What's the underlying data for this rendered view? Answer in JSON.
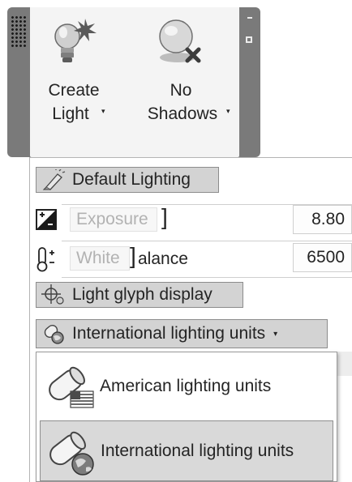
{
  "ribbon": {
    "create_light": {
      "line1": "Create",
      "line2": "Light",
      "caret": "▾",
      "icon": "light-bulb-star-icon"
    },
    "no_shadows": {
      "line1": "No",
      "line2": "Shadows",
      "caret": "▾",
      "icon": "sphere-shadow-off-icon"
    }
  },
  "panel": {
    "default_lighting": {
      "label": "Default Lighting",
      "icon": "pencil-light-icon"
    },
    "exposure": {
      "placeholder": "Exposure",
      "value": "8.80",
      "icon": "exposure-icon"
    },
    "white_balance": {
      "placeholder": "White",
      "text": "alance",
      "value": "6500",
      "icon": "thermometer-icon"
    },
    "light_glyph": {
      "label": "Light glyph display",
      "icon": "light-glyph-icon"
    },
    "units": {
      "label": "International lighting units",
      "caret": "▾",
      "icon": "globe-light-icon"
    }
  },
  "dropdown": {
    "items": [
      {
        "label": "American lighting units",
        "icon": "american-flag-light-icon",
        "selected": false
      },
      {
        "label": "International lighting units",
        "icon": "globe-light-icon",
        "selected": true
      }
    ]
  },
  "colors": {
    "panel_background": "#7a7a7a",
    "button_fill": "#d3d3d3",
    "selected_item": "#d9d9d9"
  }
}
